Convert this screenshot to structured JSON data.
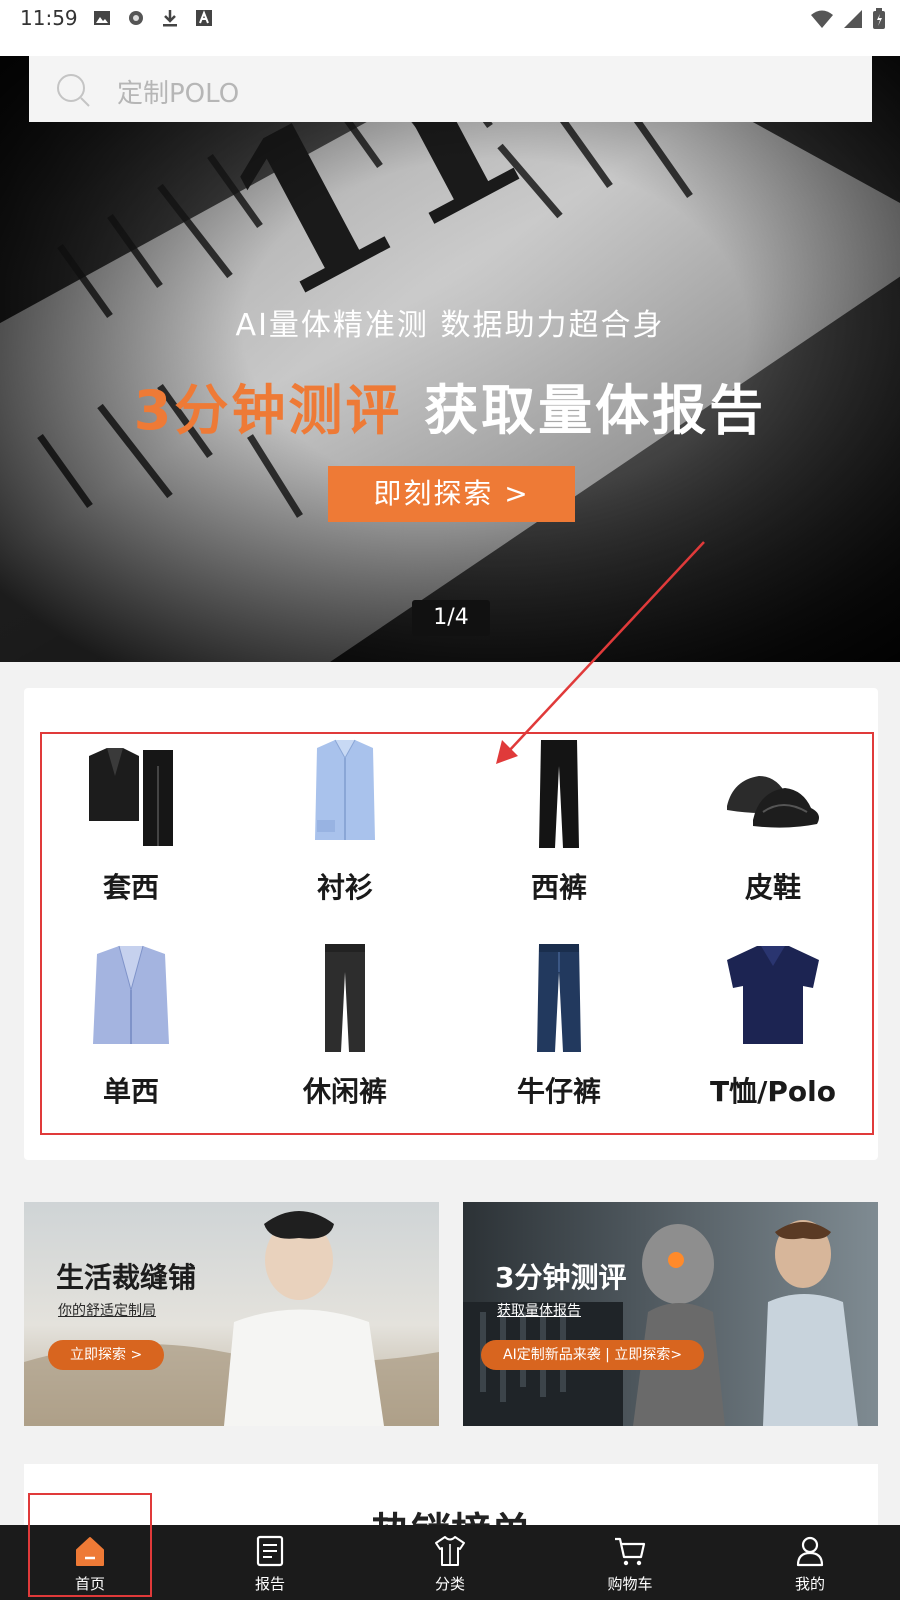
{
  "status_bar": {
    "time": "11:59"
  },
  "search": {
    "placeholder": "定制POLO"
  },
  "hero": {
    "subtitle": "AI量体精准测 数据助力超合身",
    "title_orange": "3分钟测评",
    "title_white": "获取量体报告",
    "button": "即刻探索 >",
    "pager": "1/4",
    "tape_number": "11"
  },
  "categories": [
    {
      "label": "套西",
      "icon": "suit-icon"
    },
    {
      "label": "衬衫",
      "icon": "shirt-icon"
    },
    {
      "label": "西裤",
      "icon": "trousers-icon"
    },
    {
      "label": "皮鞋",
      "icon": "shoes-icon"
    },
    {
      "label": "单西",
      "icon": "blazer-icon"
    },
    {
      "label": "休闲裤",
      "icon": "casual-pants-icon"
    },
    {
      "label": "牛仔裤",
      "icon": "jeans-icon"
    },
    {
      "label": "T恤/Polo",
      "icon": "polo-icon"
    }
  ],
  "promos": {
    "left": {
      "title": "生活裁缝铺",
      "subtitle": "你的舒适定制局",
      "button": "立即探索 >"
    },
    "right": {
      "title": "3分钟测评",
      "subtitle": "获取量体报告",
      "button": "AI定制新品来袭 | 立即探索>"
    }
  },
  "hot_section": {
    "title": "热销榜单"
  },
  "tabbar": {
    "items": [
      {
        "label": "首页",
        "icon": "home-icon",
        "active": true
      },
      {
        "label": "报告",
        "icon": "report-icon"
      },
      {
        "label": "分类",
        "icon": "category-shirt-icon"
      },
      {
        "label": "购物车",
        "icon": "cart-icon"
      },
      {
        "label": "我的",
        "icon": "profile-icon"
      }
    ]
  },
  "colors": {
    "accent": "#ee7a36",
    "annotation_red": "#e03a3a",
    "tabbar_bg": "#1b1b1b"
  }
}
